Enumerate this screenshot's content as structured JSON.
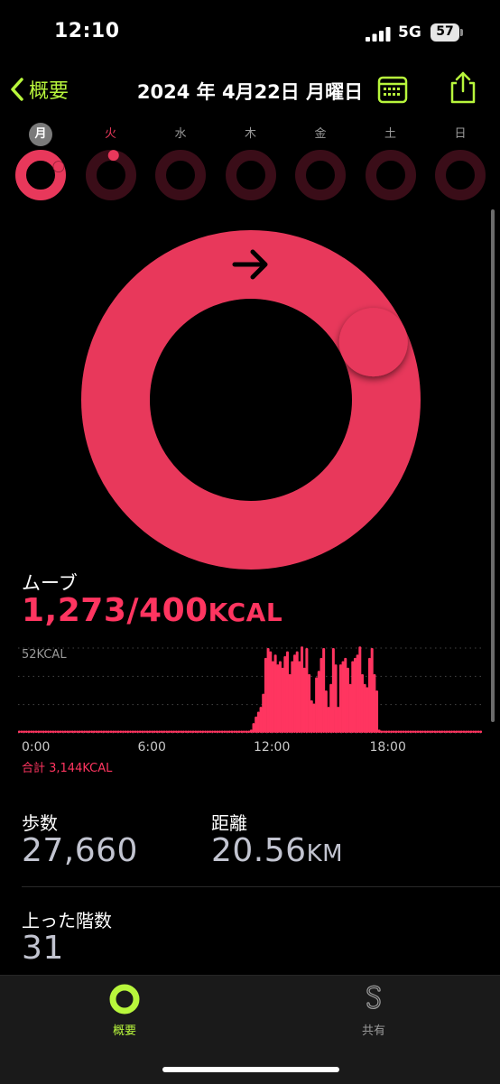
{
  "status_bar": {
    "time": "12:10",
    "network": "5G",
    "battery": "57"
  },
  "nav": {
    "back_label": "概要",
    "title": "2024 年 4月22日 月曜日"
  },
  "week": [
    {
      "label": "月",
      "state": "today",
      "progress": 3.18
    },
    {
      "label": "火",
      "state": "prev",
      "progress": 0.02
    },
    {
      "label": "水",
      "state": "empty",
      "progress": 0
    },
    {
      "label": "木",
      "state": "empty",
      "progress": 0
    },
    {
      "label": "金",
      "state": "empty",
      "progress": 0
    },
    {
      "label": "土",
      "state": "empty",
      "progress": 0
    },
    {
      "label": "日",
      "state": "empty",
      "progress": 0
    }
  ],
  "move": {
    "title": "ムーブ",
    "value": "1,273/400",
    "unit": "KCAL",
    "progress": 3.18,
    "chart_max_label": "52KCAL",
    "total_label": "合計 3,144KCAL"
  },
  "colors": {
    "accent": "#b8f63c",
    "move": "#ff3560",
    "ring": "#e8385b"
  },
  "chart_data": {
    "type": "bar",
    "title": "",
    "xlabel": "",
    "ylabel": "",
    "x_ticks": [
      "0:00",
      "6:00",
      "12:00",
      "18:00"
    ],
    "y_max_label": "52KCAL",
    "ylim": [
      0,
      52
    ],
    "x_range": [
      0,
      24
    ],
    "interval_minutes": 15,
    "values": [
      0.5,
      0.5,
      0.5,
      0.5,
      0.5,
      0.5,
      0.5,
      0.5,
      0.5,
      0.5,
      0.5,
      0.5,
      0.5,
      0.5,
      0.5,
      0.5,
      0.5,
      0.5,
      0.5,
      0.5,
      0.5,
      0.5,
      0.5,
      0.5,
      0.5,
      0.5,
      0.5,
      0.5,
      0.5,
      0.5,
      0.5,
      0.5,
      0.5,
      0.5,
      0.5,
      0.5,
      0.5,
      0.5,
      0.5,
      0.5,
      0.5,
      0.5,
      0.5,
      0.5,
      0.5,
      0.5,
      0.5,
      0.5,
      0.5,
      0.5,
      0.5,
      0.5,
      0.5,
      0.5,
      0.5,
      0.5,
      0.5,
      0.5,
      0.5,
      0.5,
      0.5,
      0.5,
      0.5,
      0.5,
      0.5,
      0.5,
      0.5,
      0.5,
      0.5,
      0.5,
      0.5,
      0.5,
      0.5,
      0.5,
      0.5,
      0.5,
      0.5,
      0.5,
      0.5,
      0.5,
      0.5,
      0.5,
      0.5,
      0.5,
      0.5,
      0.5,
      0.5,
      0.5,
      0.5,
      0.5,
      0.5,
      0.5,
      0.5,
      0.5,
      0.5,
      0.5,
      2,
      6,
      10,
      13,
      16,
      24,
      46,
      52,
      50,
      44,
      48,
      42,
      44,
      40,
      47,
      50,
      36,
      44,
      48,
      50,
      44,
      53,
      40,
      52,
      36,
      20,
      18,
      34,
      38,
      46,
      52,
      26,
      16,
      30,
      52,
      42,
      16,
      42,
      44,
      46,
      40,
      30,
      44,
      46,
      48,
      53,
      36,
      30,
      28,
      46,
      52,
      36,
      26,
      2,
      1,
      0.5,
      0.5,
      0.5,
      0.5,
      0.5,
      0.5,
      0.5,
      0.5,
      0.5,
      0.5,
      0.5,
      0.5,
      0.5,
      0.5,
      0.5,
      0.5,
      0.5,
      0.5,
      0.5,
      0.5,
      0.5,
      1,
      0.5,
      0.5,
      0.5,
      0.5,
      0.5,
      0.5,
      0.5,
      0.5,
      0.5,
      0.5,
      0.5,
      0.5,
      0.5,
      0.5,
      0.5,
      0.5,
      0.5,
      0.5,
      0.5
    ]
  },
  "stats": {
    "steps_label": "歩数",
    "steps_value": "27,660",
    "distance_label": "距離",
    "distance_value": "20.56",
    "distance_unit": "KM",
    "floors_label": "上った階数",
    "floors_value": "31"
  },
  "tabs": [
    {
      "label": "概要",
      "active": true
    },
    {
      "label": "共有",
      "active": false
    }
  ]
}
